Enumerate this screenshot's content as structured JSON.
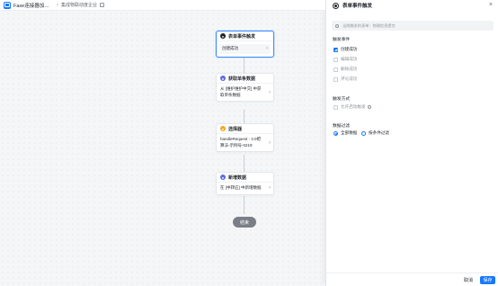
{
  "header": {
    "app_title": "Fase连接器加密事...",
    "breadcrumb": "集成物联动度企业"
  },
  "flow": {
    "nodes": [
      {
        "icon": "bell-icon",
        "icon_color": "#1f2329",
        "title": "表单事件触发",
        "body": "创建成功"
      },
      {
        "icon": "data-icon",
        "icon_color": "#5b6ee1",
        "title": "获取单条数据",
        "body": "从 [维护维护中交] 中获取单条数据"
      },
      {
        "icon": "branch-icon",
        "icon_color": "#f5a623",
        "title": "选择器",
        "body": "handleRequest - 3.0把算法-示例号-0219"
      },
      {
        "icon": "plus-data-icon",
        "icon_color": "#5b6ee1",
        "title": "新增数据",
        "body": "在 [中转应] 中新增数据"
      }
    ],
    "end_label": "结束"
  },
  "panel": {
    "title": "表单事件触发",
    "close_glyph": "×",
    "info_text": "当前触发的表单：物理信息提交",
    "trigger_section": "触发事件",
    "trigger_options": [
      {
        "label": "创建成功",
        "checked": true
      },
      {
        "label": "编辑成功",
        "checked": false
      },
      {
        "label": "删除成功",
        "checked": false
      },
      {
        "label": "评论成功",
        "checked": false
      }
    ],
    "mode_section": "触发方式",
    "mode_option": "允许启动触发",
    "filter_section": "数据过滤",
    "filter_options": [
      {
        "label": "全部数据",
        "selected": true
      },
      {
        "label": "按条件过滤",
        "selected": false
      }
    ],
    "cancel_label": "取消",
    "save_label": "保存"
  }
}
